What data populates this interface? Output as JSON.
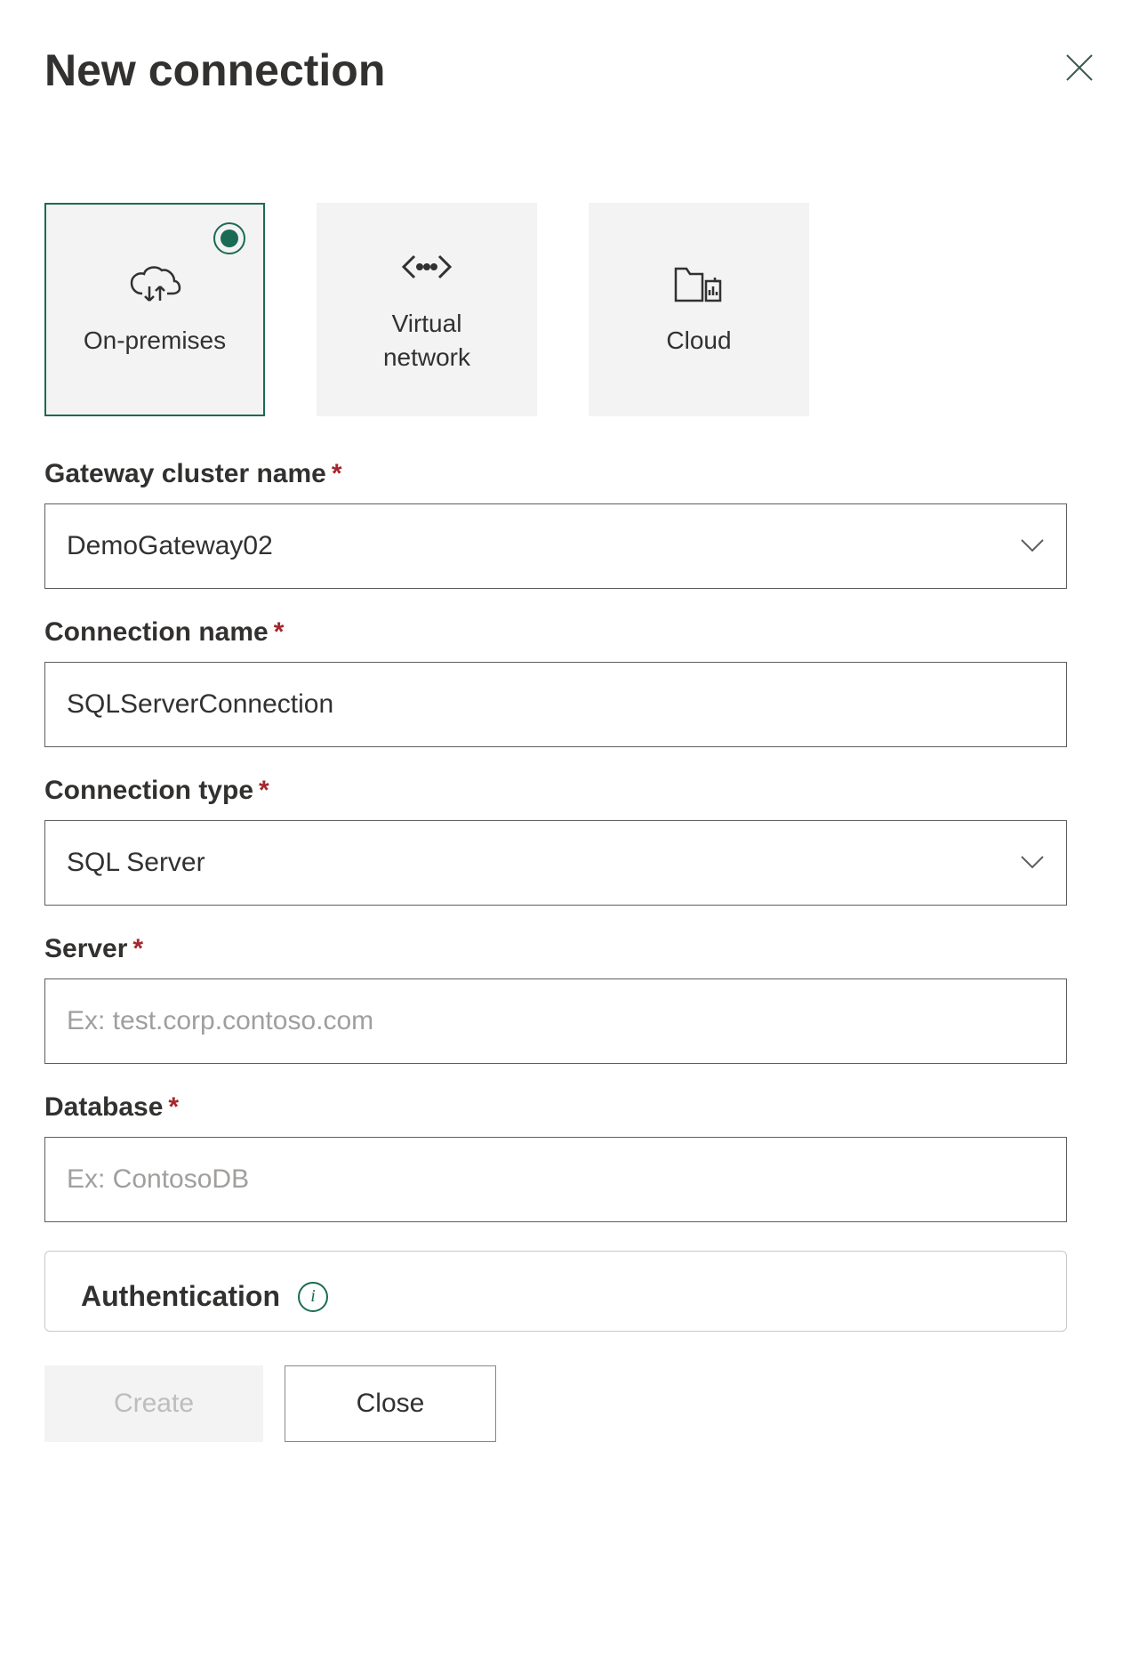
{
  "header": {
    "title": "New connection"
  },
  "options": {
    "on_premises_label": "On-premises",
    "virtual_network_label": "Virtual\nnetwork",
    "cloud_label": "Cloud"
  },
  "form": {
    "gateway_cluster": {
      "label": "Gateway cluster name",
      "value": "DemoGateway02"
    },
    "connection_name": {
      "label": "Connection name",
      "value": "SQLServerConnection"
    },
    "connection_type": {
      "label": "Connection type",
      "value": "SQL Server"
    },
    "server": {
      "label": "Server",
      "placeholder": "Ex: test.corp.contoso.com",
      "value": ""
    },
    "database": {
      "label": "Database",
      "placeholder": "Ex: ContosoDB",
      "value": ""
    },
    "authentication": {
      "label": "Authentication"
    }
  },
  "buttons": {
    "create": "Create",
    "close": "Close"
  }
}
